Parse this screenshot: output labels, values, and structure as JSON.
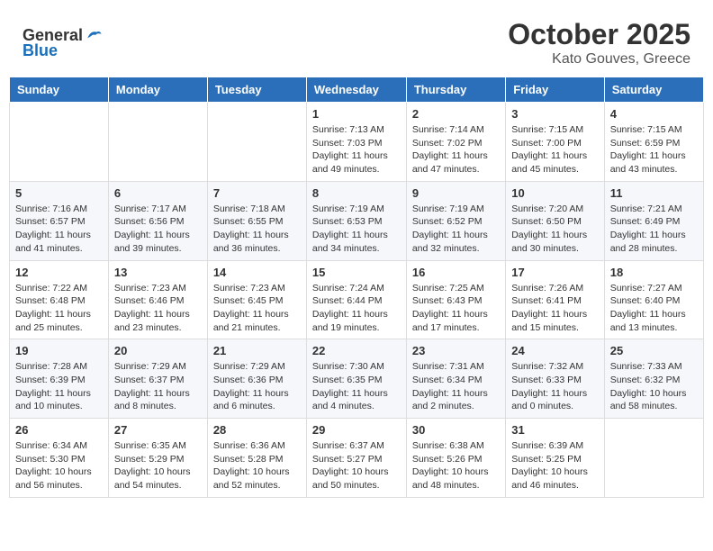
{
  "header": {
    "logo_general": "General",
    "logo_blue": "Blue",
    "month": "October 2025",
    "location": "Kato Gouves, Greece"
  },
  "weekdays": [
    "Sunday",
    "Monday",
    "Tuesday",
    "Wednesday",
    "Thursday",
    "Friday",
    "Saturday"
  ],
  "weeks": [
    [
      {
        "day": "",
        "info": ""
      },
      {
        "day": "",
        "info": ""
      },
      {
        "day": "",
        "info": ""
      },
      {
        "day": "1",
        "info": "Sunrise: 7:13 AM\nSunset: 7:03 PM\nDaylight: 11 hours and 49 minutes."
      },
      {
        "day": "2",
        "info": "Sunrise: 7:14 AM\nSunset: 7:02 PM\nDaylight: 11 hours and 47 minutes."
      },
      {
        "day": "3",
        "info": "Sunrise: 7:15 AM\nSunset: 7:00 PM\nDaylight: 11 hours and 45 minutes."
      },
      {
        "day": "4",
        "info": "Sunrise: 7:15 AM\nSunset: 6:59 PM\nDaylight: 11 hours and 43 minutes."
      }
    ],
    [
      {
        "day": "5",
        "info": "Sunrise: 7:16 AM\nSunset: 6:57 PM\nDaylight: 11 hours and 41 minutes."
      },
      {
        "day": "6",
        "info": "Sunrise: 7:17 AM\nSunset: 6:56 PM\nDaylight: 11 hours and 39 minutes."
      },
      {
        "day": "7",
        "info": "Sunrise: 7:18 AM\nSunset: 6:55 PM\nDaylight: 11 hours and 36 minutes."
      },
      {
        "day": "8",
        "info": "Sunrise: 7:19 AM\nSunset: 6:53 PM\nDaylight: 11 hours and 34 minutes."
      },
      {
        "day": "9",
        "info": "Sunrise: 7:19 AM\nSunset: 6:52 PM\nDaylight: 11 hours and 32 minutes."
      },
      {
        "day": "10",
        "info": "Sunrise: 7:20 AM\nSunset: 6:50 PM\nDaylight: 11 hours and 30 minutes."
      },
      {
        "day": "11",
        "info": "Sunrise: 7:21 AM\nSunset: 6:49 PM\nDaylight: 11 hours and 28 minutes."
      }
    ],
    [
      {
        "day": "12",
        "info": "Sunrise: 7:22 AM\nSunset: 6:48 PM\nDaylight: 11 hours and 25 minutes."
      },
      {
        "day": "13",
        "info": "Sunrise: 7:23 AM\nSunset: 6:46 PM\nDaylight: 11 hours and 23 minutes."
      },
      {
        "day": "14",
        "info": "Sunrise: 7:23 AM\nSunset: 6:45 PM\nDaylight: 11 hours and 21 minutes."
      },
      {
        "day": "15",
        "info": "Sunrise: 7:24 AM\nSunset: 6:44 PM\nDaylight: 11 hours and 19 minutes."
      },
      {
        "day": "16",
        "info": "Sunrise: 7:25 AM\nSunset: 6:43 PM\nDaylight: 11 hours and 17 minutes."
      },
      {
        "day": "17",
        "info": "Sunrise: 7:26 AM\nSunset: 6:41 PM\nDaylight: 11 hours and 15 minutes."
      },
      {
        "day": "18",
        "info": "Sunrise: 7:27 AM\nSunset: 6:40 PM\nDaylight: 11 hours and 13 minutes."
      }
    ],
    [
      {
        "day": "19",
        "info": "Sunrise: 7:28 AM\nSunset: 6:39 PM\nDaylight: 11 hours and 10 minutes."
      },
      {
        "day": "20",
        "info": "Sunrise: 7:29 AM\nSunset: 6:37 PM\nDaylight: 11 hours and 8 minutes."
      },
      {
        "day": "21",
        "info": "Sunrise: 7:29 AM\nSunset: 6:36 PM\nDaylight: 11 hours and 6 minutes."
      },
      {
        "day": "22",
        "info": "Sunrise: 7:30 AM\nSunset: 6:35 PM\nDaylight: 11 hours and 4 minutes."
      },
      {
        "day": "23",
        "info": "Sunrise: 7:31 AM\nSunset: 6:34 PM\nDaylight: 11 hours and 2 minutes."
      },
      {
        "day": "24",
        "info": "Sunrise: 7:32 AM\nSunset: 6:33 PM\nDaylight: 11 hours and 0 minutes."
      },
      {
        "day": "25",
        "info": "Sunrise: 7:33 AM\nSunset: 6:32 PM\nDaylight: 10 hours and 58 minutes."
      }
    ],
    [
      {
        "day": "26",
        "info": "Sunrise: 6:34 AM\nSunset: 5:30 PM\nDaylight: 10 hours and 56 minutes."
      },
      {
        "day": "27",
        "info": "Sunrise: 6:35 AM\nSunset: 5:29 PM\nDaylight: 10 hours and 54 minutes."
      },
      {
        "day": "28",
        "info": "Sunrise: 6:36 AM\nSunset: 5:28 PM\nDaylight: 10 hours and 52 minutes."
      },
      {
        "day": "29",
        "info": "Sunrise: 6:37 AM\nSunset: 5:27 PM\nDaylight: 10 hours and 50 minutes."
      },
      {
        "day": "30",
        "info": "Sunrise: 6:38 AM\nSunset: 5:26 PM\nDaylight: 10 hours and 48 minutes."
      },
      {
        "day": "31",
        "info": "Sunrise: 6:39 AM\nSunset: 5:25 PM\nDaylight: 10 hours and 46 minutes."
      },
      {
        "day": "",
        "info": ""
      }
    ]
  ]
}
